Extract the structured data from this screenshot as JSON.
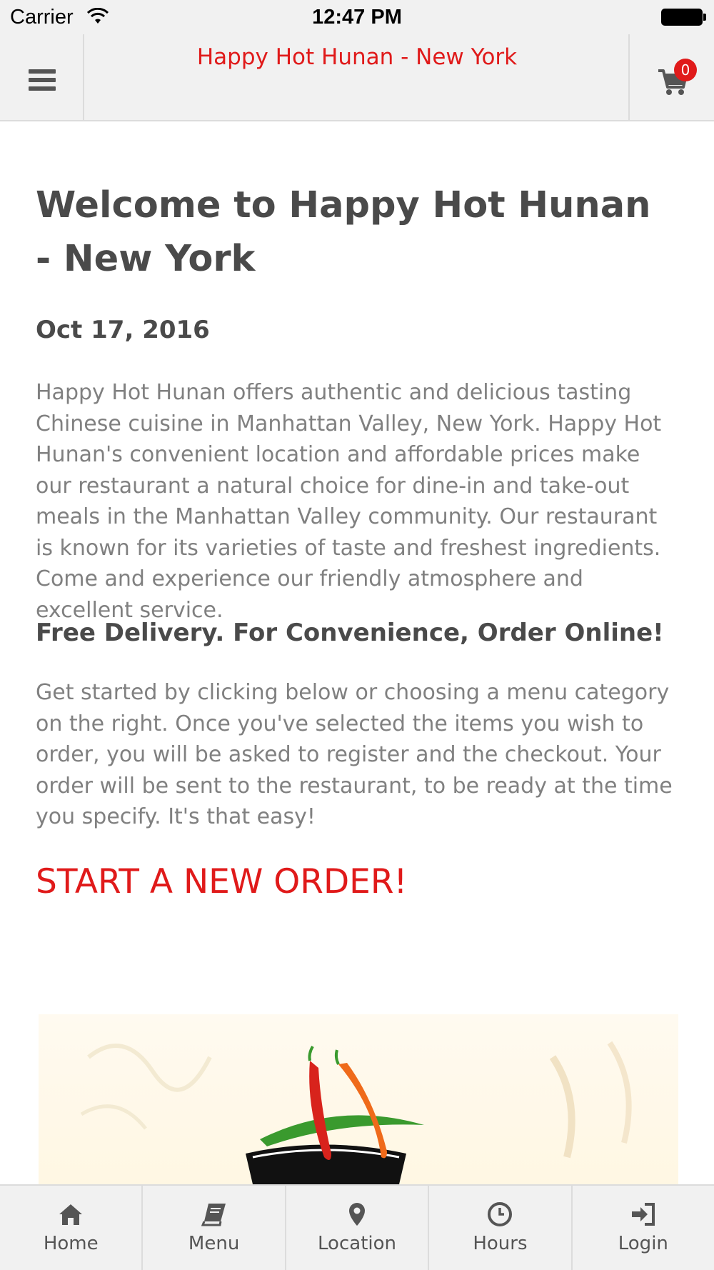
{
  "status_bar": {
    "carrier": "Carrier",
    "time": "12:47 PM"
  },
  "header": {
    "title": "Happy Hot Hunan - New York",
    "cart_count": "0",
    "accent_color": "#e01a1a"
  },
  "main": {
    "welcome_title": "Welcome to Happy Hot Hunan - New York",
    "date": "Oct 17, 2016",
    "intro": "Happy Hot Hunan offers authentic and delicious tasting Chinese cuisine in Manhattan Valley, New York.  Happy Hot Hunan's convenient location and affordable prices make our restaurant a natural choice for dine-in and take-out meals in the Manhattan Valley community. Our restaurant is known for its varieties of taste and freshest ingredients. Come and experience our friendly atmosphere and excellent service.",
    "subheading": "Free Delivery. For Convenience, Order Online!",
    "instructions": "Get started by clicking below or choosing a menu category on the right. Once you've selected the items you wish to order, you will be asked to register and the checkout. Your order will be sent to the restaurant, to be ready at the time you specify. It's that easy!",
    "start_order_link": "START A NEW ORDER!"
  },
  "tabs": [
    {
      "label": "Home",
      "icon": "home-icon"
    },
    {
      "label": "Menu",
      "icon": "book-icon"
    },
    {
      "label": "Location",
      "icon": "map-marker-icon"
    },
    {
      "label": "Hours",
      "icon": "clock-icon"
    },
    {
      "label": "Login",
      "icon": "sign-in-icon"
    }
  ]
}
